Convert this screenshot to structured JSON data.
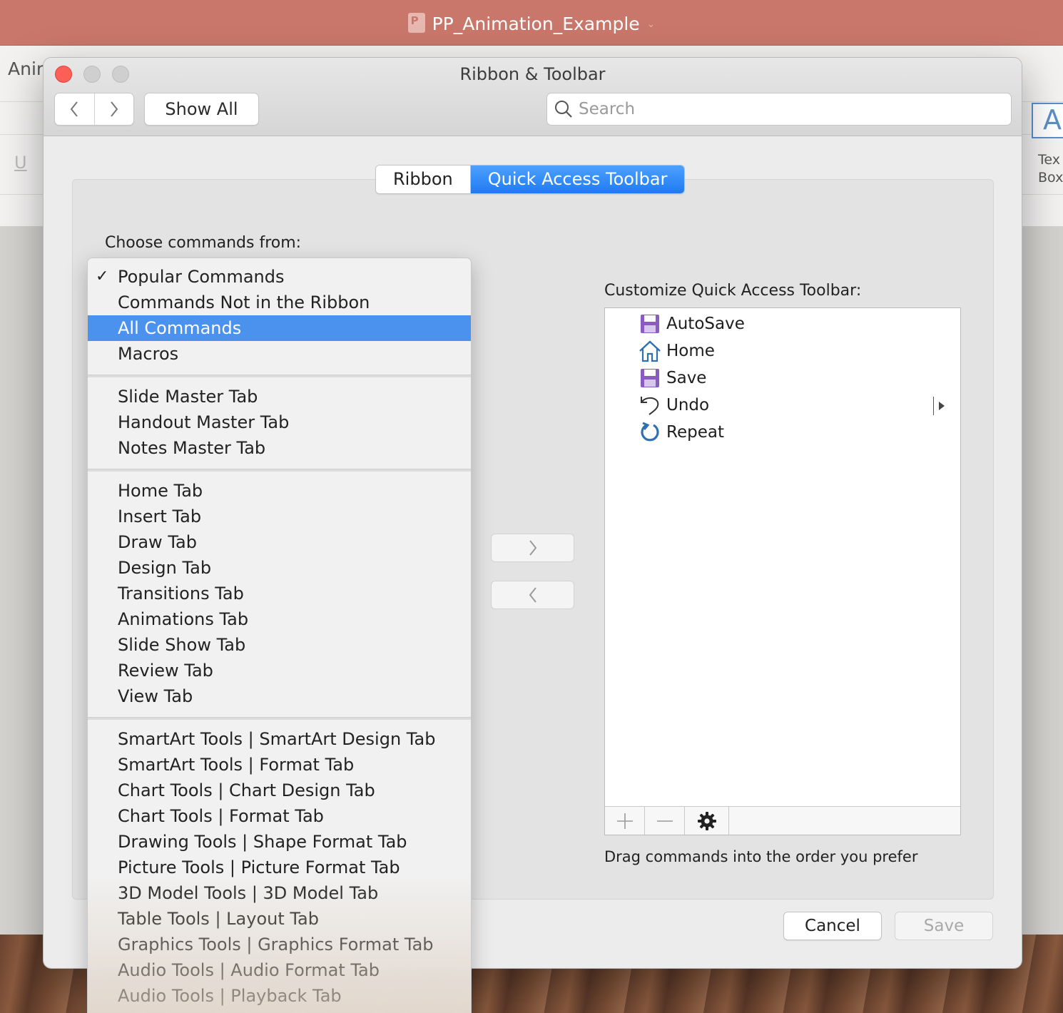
{
  "app": {
    "document_title": "PP_Animation_Example",
    "ribbon_tab_partial": "Anir",
    "textbox_label_line1": "Tex",
    "textbox_label_line2": "Box",
    "textbox_icon_glyph": "A",
    "underline_glyph": "U"
  },
  "dialog": {
    "title": "Ribbon & Toolbar",
    "show_all_label": "Show All",
    "search_placeholder": "Search",
    "tabs": [
      {
        "label": "Ribbon",
        "active": false
      },
      {
        "label": "Quick Access Toolbar",
        "active": true
      }
    ],
    "choose_label": "Choose commands from:",
    "customize_label": "Customize Quick Access Toolbar:",
    "hint": "Drag commands into the order you prefer",
    "cancel_label": "Cancel",
    "save_label": "Save"
  },
  "menu": {
    "selected_value": "Popular Commands",
    "groups": [
      [
        "Popular Commands",
        "Commands Not in the Ribbon",
        "All Commands",
        "Macros"
      ],
      [
        "Slide Master Tab",
        "Handout Master Tab",
        "Notes Master Tab"
      ],
      [
        "Home Tab",
        "Insert Tab",
        "Draw Tab",
        "Design Tab",
        "Transitions Tab",
        "Animations Tab",
        "Slide Show Tab",
        "Review Tab",
        "View Tab"
      ],
      [
        "SmartArt Tools | SmartArt Design Tab",
        "SmartArt Tools | Format Tab",
        "Chart Tools | Chart Design Tab",
        "Chart Tools | Format Tab",
        "Drawing Tools | Shape Format Tab",
        "Picture Tools | Picture Format Tab",
        "3D Model Tools | 3D Model Tab",
        "Table Tools | Layout Tab",
        "Graphics Tools | Graphics Format Tab",
        "Audio Tools | Audio Format Tab",
        "Audio Tools | Playback Tab"
      ]
    ],
    "highlighted": "All Commands"
  },
  "qat_items": [
    {
      "label": "AutoSave",
      "icon": "floppy-disk-icon"
    },
    {
      "label": "Home",
      "icon": "home-icon"
    },
    {
      "label": "Save",
      "icon": "floppy-disk-icon"
    },
    {
      "label": "Undo",
      "icon": "undo-icon"
    },
    {
      "label": "Repeat",
      "icon": "repeat-icon"
    }
  ],
  "colors": {
    "accent": "#1f7bf2",
    "menu_highlight": "#4b92ef",
    "titlebar": "#c9776a",
    "save_icon": "#8a5bc0",
    "home_icon": "#2f6fb3"
  }
}
